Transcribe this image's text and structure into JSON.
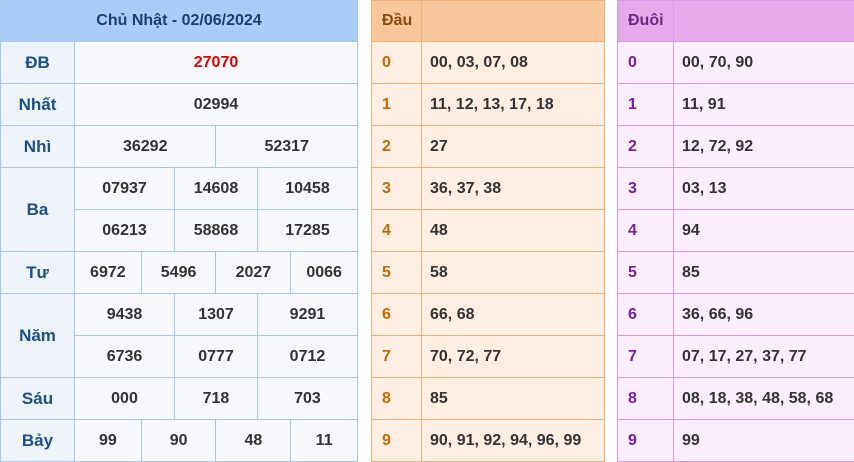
{
  "results": {
    "title": "Chủ Nhật - 02/06/2024",
    "rows": {
      "db": {
        "label": "ĐB",
        "values": [
          "27070"
        ]
      },
      "nhat": {
        "label": "Nhất",
        "values": [
          "02994"
        ]
      },
      "nhi": {
        "label": "Nhì",
        "values": [
          "36292",
          "52317"
        ]
      },
      "ba": {
        "label": "Ba",
        "values": [
          "07937",
          "14608",
          "10458",
          "06213",
          "58868",
          "17285"
        ]
      },
      "tu": {
        "label": "Tư",
        "values": [
          "6972",
          "5496",
          "2027",
          "0066"
        ]
      },
      "nam": {
        "label": "Năm",
        "values": [
          "9438",
          "1307",
          "9291",
          "6736",
          "0777",
          "0712"
        ]
      },
      "sau": {
        "label": "Sáu",
        "values": [
          "000",
          "718",
          "703"
        ]
      },
      "bay": {
        "label": "Bảy",
        "values": [
          "99",
          "90",
          "48",
          "11"
        ]
      }
    }
  },
  "dau": {
    "title": "Đầu",
    "rows": [
      {
        "k": "0",
        "v": "00, 03, 07, 08"
      },
      {
        "k": "1",
        "v": "11, 12, 13, 17, 18"
      },
      {
        "k": "2",
        "v": "27"
      },
      {
        "k": "3",
        "v": "36, 37, 38"
      },
      {
        "k": "4",
        "v": "48"
      },
      {
        "k": "5",
        "v": "58"
      },
      {
        "k": "6",
        "v": "66, 68"
      },
      {
        "k": "7",
        "v": "70, 72, 77"
      },
      {
        "k": "8",
        "v": "85"
      },
      {
        "k": "9",
        "v": "90, 91, 92, 94, 96, 99"
      }
    ]
  },
  "duoi": {
    "title": "Đuôi",
    "rows": [
      {
        "k": "0",
        "v": "00, 70, 90"
      },
      {
        "k": "1",
        "v": "11, 91"
      },
      {
        "k": "2",
        "v": "12, 72, 92"
      },
      {
        "k": "3",
        "v": "03, 13"
      },
      {
        "k": "4",
        "v": "94"
      },
      {
        "k": "5",
        "v": "85"
      },
      {
        "k": "6",
        "v": "36, 66, 96"
      },
      {
        "k": "7",
        "v": "07, 17, 27, 37, 77"
      },
      {
        "k": "8",
        "v": "08, 18, 38, 48, 58, 68"
      },
      {
        "k": "9",
        "v": "99"
      }
    ]
  },
  "colors": {
    "results_header": "#a9cbf7",
    "dau_header": "#fac79b",
    "duoi_header": "#e5abe9",
    "special_prize": "#e60000"
  }
}
